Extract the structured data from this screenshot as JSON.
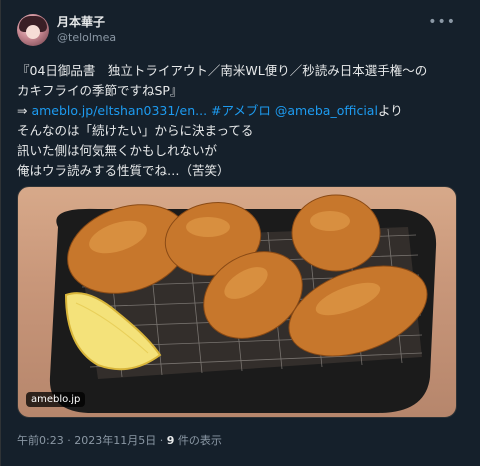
{
  "author": {
    "display_name": "月本華子",
    "handle": "@telolmea"
  },
  "tweet": {
    "line1": "『04日御品書　独立トライアウト／南米WL便り／秒読み日本選手権～の",
    "line2": "カキフライの季節ですねSP』",
    "line3_arrow": "⇒ ",
    "line3_link1": "ameblo.jp/eltshan0331/en...",
    "line3_hashtag": " #アメブロ",
    "line3_mention": " @ameba_official",
    "line3_suffix": "より",
    "line4": "そんなのは「続けたい」からに決まってる",
    "line5": "訊いた側は何気無くかもしれないが",
    "line6": "俺はウラ読みする性質でね…（苦笑）"
  },
  "media": {
    "badge": "ameblo.jp",
    "icon": "fried-oyster-photo"
  },
  "meta": {
    "time": "午前0:23",
    "sep1": " · ",
    "date": "2023年11月5日",
    "sep2": " · ",
    "views_count": "9",
    "views_label": " 件の表示"
  },
  "colors": {
    "background": "#15202b",
    "text": "#e7e9ea",
    "muted": "#8b98a5",
    "link": "#1d9bf0"
  }
}
